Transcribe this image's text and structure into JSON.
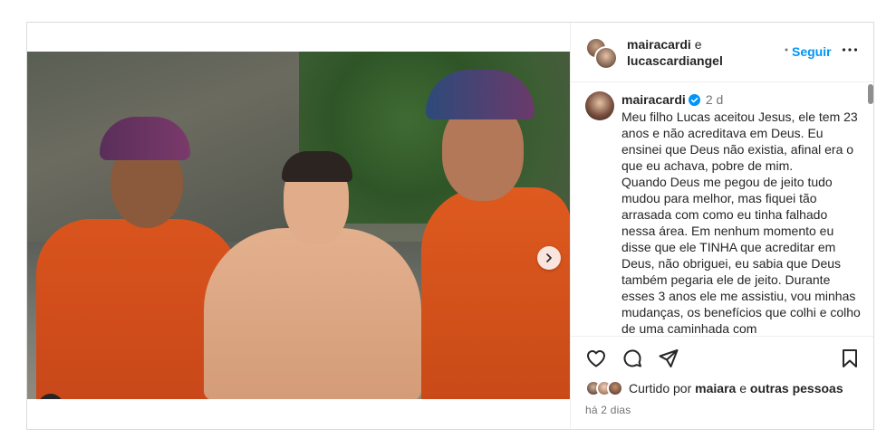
{
  "header": {
    "user1": "mairacardi",
    "connector": "e",
    "user2": "lucascardiangel",
    "follow_label": "Seguir"
  },
  "caption": {
    "username": "mairacardi",
    "time": "2 d",
    "text": "Meu filho Lucas aceitou Jesus, ele tem 23 anos e não acreditava em Deus. Eu ensinei que Deus não existia, afinal era o que eu achava, pobre de mim.\nQuando Deus me pegou de jeito tudo mudou para melhor, mas fiquei tão arrasada com como eu tinha falhado nessa área. Em nenhum momento eu disse que ele TINHA que acreditar em Deus, não obriguei, eu sabia que Deus também pegaria ele de jeito. Durante esses 3 anos ele me assistiu, vou minhas mudanças, os benefícios que colhi e colho de uma caminhada com"
  },
  "likes": {
    "prefix": "Curtido por",
    "user": "maiara",
    "connector": "e",
    "others": "outras pessoas"
  },
  "date": "há 2 dias",
  "carousel": {
    "total": 11,
    "active": 0
  },
  "colors": {
    "accent": "#0095f6",
    "text": "#262626",
    "muted": "#737373",
    "border": "#dbdbdb"
  },
  "icons": [
    "heart-icon",
    "comment-icon",
    "share-icon",
    "bookmark-icon",
    "more-icon",
    "verified-icon",
    "user-tag-icon",
    "chevron-right-icon"
  ]
}
